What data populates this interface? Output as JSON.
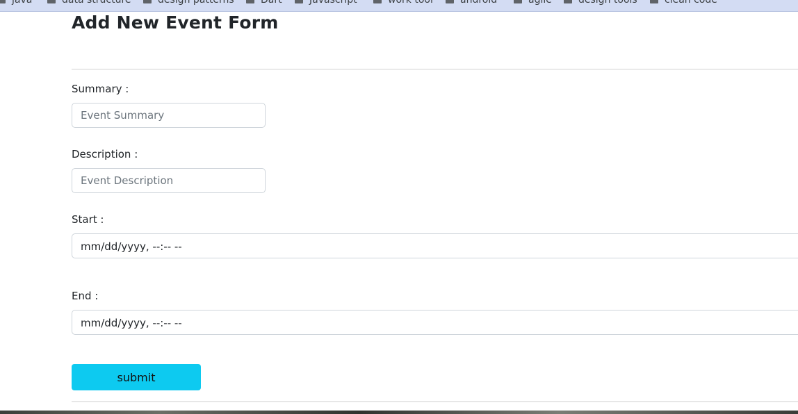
{
  "bookmarks": [
    {
      "label": "java",
      "icon": "folder-icon"
    },
    {
      "label": "data structure",
      "icon": "folder-icon"
    },
    {
      "label": "design patterns",
      "icon": "folder-icon"
    },
    {
      "label": "Dart",
      "icon": "folder-icon"
    },
    {
      "label": "Javascript",
      "icon": "folder-icon"
    },
    {
      "label": "work tool",
      "icon": "folder-icon"
    },
    {
      "label": "android",
      "icon": "folder-icon"
    },
    {
      "label": "agile",
      "icon": "folder-icon"
    },
    {
      "label": "design tools",
      "icon": "folder-icon"
    },
    {
      "label": "clean code",
      "icon": "folder-icon"
    }
  ],
  "form": {
    "title": "Add New Event Form",
    "summary": {
      "label": "Summary :",
      "placeholder": "Event Summary",
      "value": ""
    },
    "description": {
      "label": "Description :",
      "placeholder": "Event Description",
      "value": ""
    },
    "start": {
      "label": "Start :",
      "display": "mm/dd/yyyy, --:-- --"
    },
    "end": {
      "label": "End :",
      "display": "mm/dd/yyyy, --:-- --"
    },
    "submit_label": "submit"
  },
  "colors": {
    "submit_button": "#0dcaf0",
    "bookmarks_bar": "#d3dcf3"
  }
}
